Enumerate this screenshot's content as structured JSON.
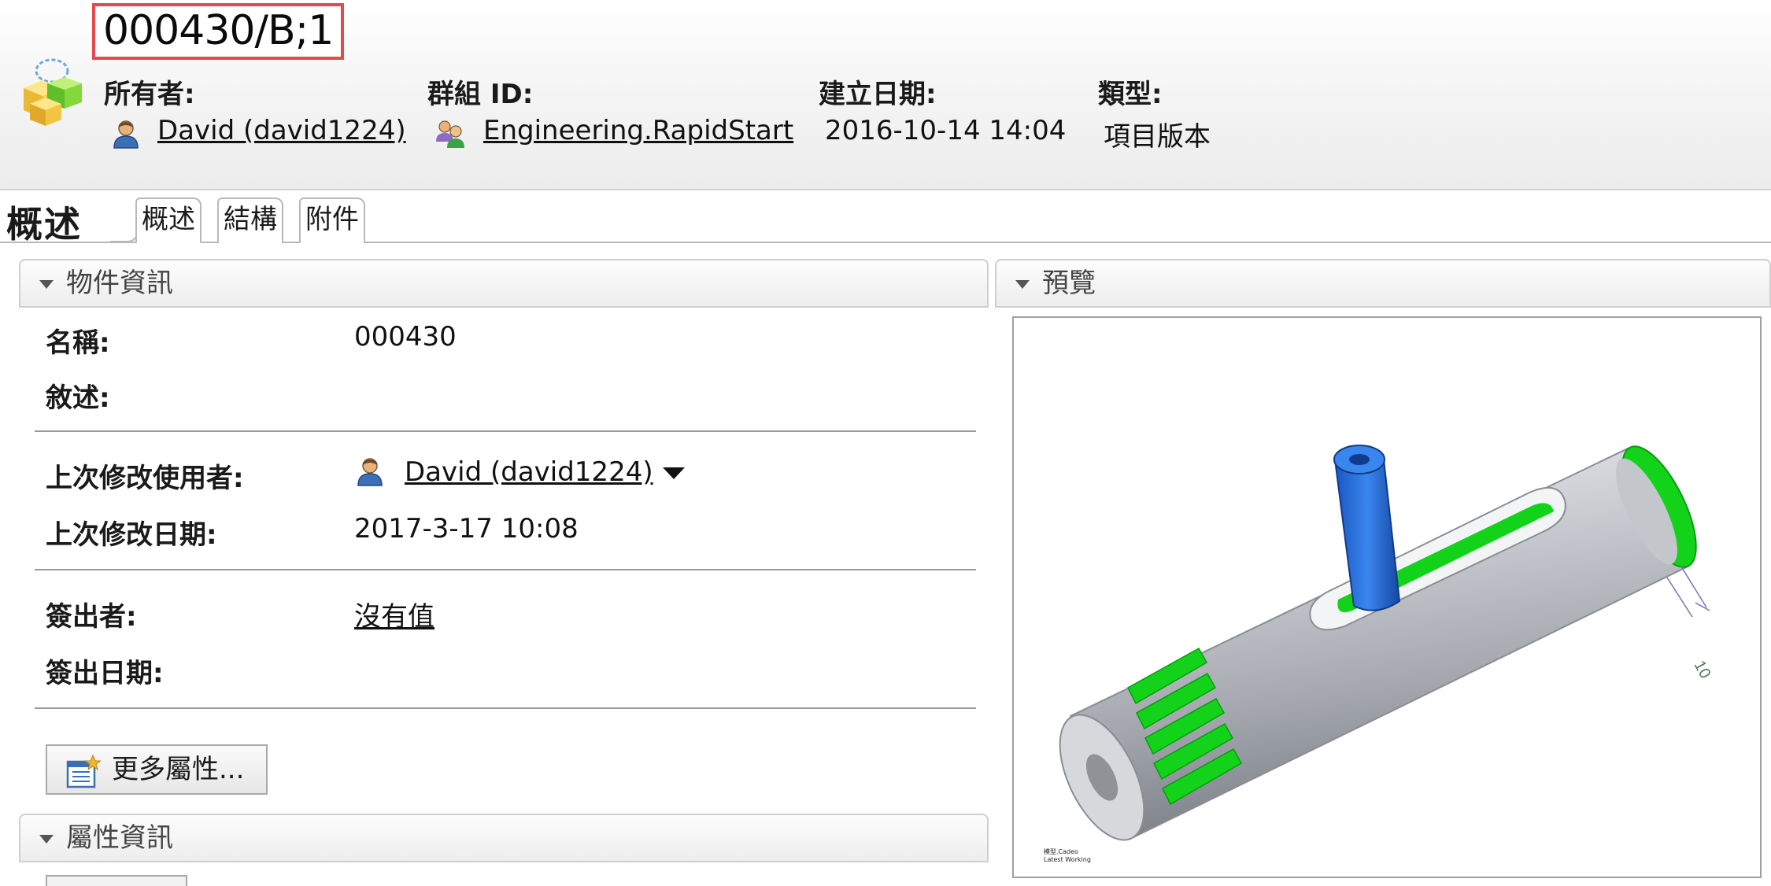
{
  "header": {
    "title": "000430/B;1",
    "owner_label": "所有者:",
    "owner_value": "David (david1224)",
    "group_label": "群組 ID:",
    "group_value": "Engineering.RapidStart",
    "created_label": "建立日期:",
    "created_value": "2016-10-14 14:04",
    "type_label": "類型:",
    "type_value": "項目版本"
  },
  "tabs": {
    "active": "概述",
    "items": [
      "概述",
      "結構",
      "附件"
    ]
  },
  "object_info": {
    "title": "物件資訊",
    "name_label": "名稱:",
    "name_value": "000430",
    "desc_label": "敘述:",
    "modifier_label": "上次修改使用者:",
    "modifier_value": "David (david1224)",
    "modified_date_label": "上次修改日期:",
    "modified_date_value": "2017-3-17 10:08",
    "checkout_user_label": "簽出者:",
    "checkout_user_value": "沒有值",
    "checkout_date_label": "簽出日期:",
    "more_button": "更多屬性..."
  },
  "attributes": {
    "title": "屬性資訊"
  },
  "preview": {
    "title": "預覽",
    "dimension_label": "10",
    "caption_line1": "模型.Cadeo",
    "caption_line2": "Latest Working"
  },
  "colors": {
    "title_border": "#e5484d",
    "part_green": "#12d31a",
    "part_blue": "#1c63d6",
    "part_gray": "#b9bcc1"
  }
}
